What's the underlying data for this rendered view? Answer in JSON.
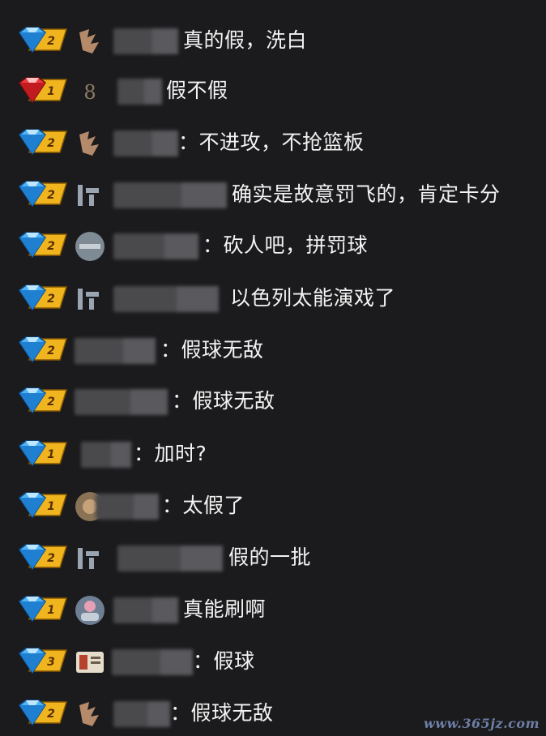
{
  "messages": [
    {
      "level": "2",
      "tier": "diamond",
      "text": "真的假，洗白"
    },
    {
      "level": "1",
      "tier": "ruby",
      "text": "假不假"
    },
    {
      "level": "2",
      "tier": "diamond",
      "text": "：不进攻，不抢篮板"
    },
    {
      "level": "2",
      "tier": "diamond",
      "text": "确实是故意罚飞的，肯定卡分"
    },
    {
      "level": "2",
      "tier": "diamond",
      "text": "：砍人吧，拼罚球"
    },
    {
      "level": "2",
      "tier": "diamond",
      "text": "以色列太能演戏了"
    },
    {
      "level": "2",
      "tier": "diamond",
      "text": "：假球无敌"
    },
    {
      "level": "2",
      "tier": "diamond",
      "text": "：假球无敌"
    },
    {
      "level": "1",
      "tier": "diamond",
      "text": "：加时?"
    },
    {
      "level": "1",
      "tier": "diamond",
      "text": "：太假了"
    },
    {
      "level": "2",
      "tier": "diamond",
      "text": "假的一批"
    },
    {
      "level": "1",
      "tier": "diamond",
      "text": "真能刷啊"
    },
    {
      "level": "3",
      "tier": "diamond",
      "text": "：假球"
    },
    {
      "level": "2",
      "tier": "diamond",
      "text": "：假球无敌"
    }
  ],
  "watermark": "www.365jz.com",
  "colors": {
    "background": "#1b1b1d",
    "text": "#f3f3f3",
    "diamond_blue": "#3fa9f5",
    "ruby_red": "#e0242a",
    "badge_gold": "#f0b51e"
  }
}
